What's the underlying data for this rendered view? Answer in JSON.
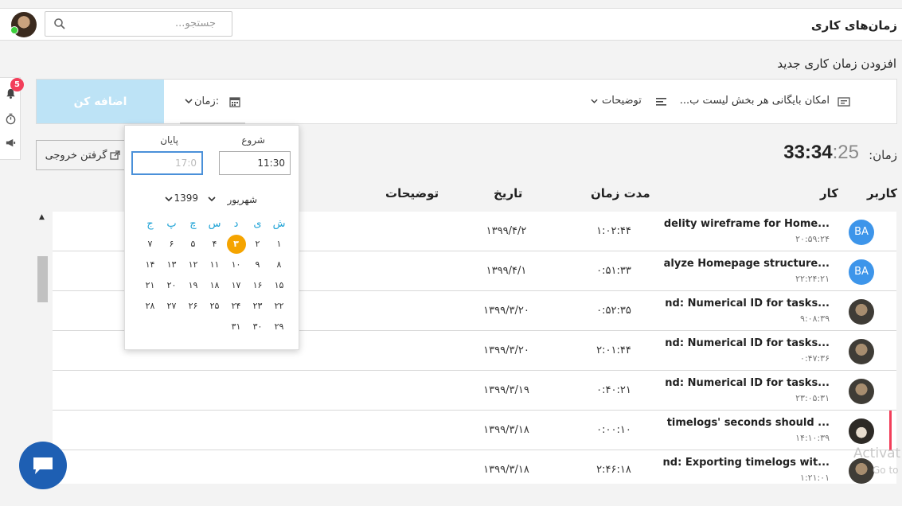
{
  "header": {
    "title": "زمان‌های کاری",
    "search_placeholder": "جستجو..."
  },
  "sidebar": {
    "notification_count": "5"
  },
  "form": {
    "section_title": "افزودن زمان کاری جدید",
    "add_button": "اضافه کن",
    "time_label": "زمان:",
    "description_label": "توضیحات",
    "project_label": "امکان بایگانی هر بخش لیست ب..."
  },
  "elapsed": {
    "label": "زمان:",
    "hours": "33",
    "sep1": ":",
    "minutes": "34",
    "sep2": ":",
    "seconds": "25"
  },
  "export_button": "گرفتن خروجی",
  "table": {
    "columns": {
      "user": "کاربر",
      "task": "کار",
      "duration": "مدت زمان",
      "date": "تاریخ",
      "description": "توضیحات"
    },
    "rows": [
      {
        "user": "BA",
        "task": "delity wireframe for Home...",
        "time": "۲۰:۵۹:۲۴",
        "duration": "۱:۰۲:۴۴",
        "date": "۱۳۹۹/۴/۲"
      },
      {
        "user": "BA",
        "task": "alyze Homepage structure...",
        "time": "۲۲:۲۴:۲۱",
        "duration": "۰:۵۱:۳۳",
        "date": "۱۳۹۹/۴/۱"
      },
      {
        "user": "",
        "task": "nd: Numerical ID for tasks...",
        "time": "۹:۰۸:۳۹",
        "duration": "۰:۵۲:۳۵",
        "date": "۱۳۹۹/۳/۲۰"
      },
      {
        "user": "",
        "task": "nd: Numerical ID for tasks...",
        "time": "۰:۴۷:۳۶",
        "duration": "۲:۰۱:۴۴",
        "date": "۱۳۹۹/۳/۲۰"
      },
      {
        "user": "",
        "task": "nd: Numerical ID for tasks...",
        "time": "۲۳:۰۵:۳۱",
        "duration": "۰:۴۰:۲۱",
        "date": "۱۳۹۹/۳/۱۹"
      },
      {
        "user": "",
        "task": "timelogs' seconds should ...",
        "time": "۱۴:۱۰:۳۹",
        "duration": "۰:۰۰:۱۰",
        "date": "۱۳۹۹/۳/۱۸"
      },
      {
        "user": "",
        "task": "nd: Exporting timelogs wit...",
        "time": "۱:۲۱:۰۱",
        "duration": "۲:۴۶:۱۸",
        "date": "۱۳۹۹/۳/۱۸"
      }
    ]
  },
  "calendar": {
    "start_label": "شروع",
    "end_label": "پایان",
    "start_value": "11:30",
    "end_placeholder": "17:0",
    "month": "شهریور",
    "year": "1399",
    "weekdays": [
      "ش",
      "ی",
      "د",
      "س",
      "چ",
      "پ",
      "ج"
    ],
    "weeks": [
      [
        "۱",
        "۲",
        "۳",
        "۴",
        "۵",
        "۶",
        "۷"
      ],
      [
        "۸",
        "۹",
        "۱۰",
        "۱۱",
        "۱۲",
        "۱۳",
        "۱۴"
      ],
      [
        "۱۵",
        "۱۶",
        "۱۷",
        "۱۸",
        "۱۹",
        "۲۰",
        "۲۱"
      ],
      [
        "۲۲",
        "۲۳",
        "۲۴",
        "۲۵",
        "۲۶",
        "۲۷",
        "۲۸"
      ],
      [
        "۲۹",
        "۳۰",
        "۳۱",
        "",
        "",
        "",
        ""
      ]
    ],
    "selected_day": "۳"
  },
  "watermark": {
    "line1": "Activat",
    "line2": "Go to Set"
  },
  "colors": {
    "accent_blue": "#3d95ea",
    "selected_day": "#f5a400",
    "badge": "#f23e5a",
    "weekday": "#1fa3d6",
    "add_button": "#bde3f6"
  }
}
